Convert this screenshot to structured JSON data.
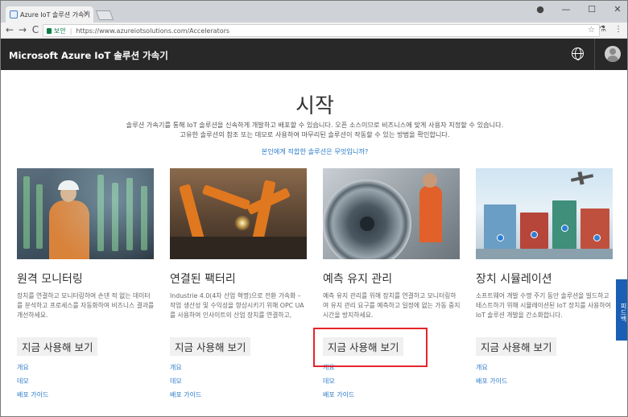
{
  "browser": {
    "tab_title": "Azure IoT 솔루션 가속기",
    "tab_close": "×",
    "url_secure_label": "보안",
    "url": "https://www.azureiotsolutions.com/Accelerators",
    "nav": {
      "back": "←",
      "forward": "→",
      "reload": "C"
    },
    "window_buttons": {
      "profile": "●",
      "minimize": "—",
      "maximize": "☐",
      "close": "✕"
    },
    "bookmark_star": "☆",
    "extension_icon": "⚗",
    "menu_icon": "⋮"
  },
  "header": {
    "title": "Microsoft Azure IoT 솔루션 가속기"
  },
  "main": {
    "heading": "시작",
    "intro_line1": "솔루션 가속기를 통해 IoT 솔루션을 신속하게 개발하고 배포할 수 있습니다. 오픈 소스이므로 비즈니스에 맞게 사용자 지정할 수 있습니다.",
    "intro_line2": "고유한 솔루션의 참조 또는 데모로 사용하여 마무리된 솔루션이 작동할 수 있는 방법을 확인합니다.",
    "intro_link": "본인에게 적합한 솔루션은 무엇입니까?"
  },
  "cards": [
    {
      "title": "원격 모니터링",
      "description": "장치를 연결하고 모니터링하여 손댄 적 없는 데이터를 분석하고 프로세스를 자동화하여 비즈니스 결과를 개선하세요.",
      "cta": "지금 사용해 보기",
      "links": [
        "개요",
        "데모",
        "배포 가이드"
      ]
    },
    {
      "title": "연결된 팩터리",
      "description": "Industrie 4.0(4차 산업 혁명)으로 전환 가속화 – 작업 생산성 및 수익성을 향상시키기 위해 OPC UA를 사용하여 인사이트의 산업 장치를 연결하고,",
      "cta": "지금 사용해 보기",
      "links": [
        "개요",
        "데모",
        "배포 가이드"
      ]
    },
    {
      "title": "예측 유지 관리",
      "description": "예측 유지 관리를 위해 장치를 연결하고 모니터링하여 유지 관리 요구를 예측하고 일정에 없는 가동 중지 시간을 방지하세요.",
      "cta": "지금 사용해 보기",
      "links": [
        "개요",
        "데모",
        "배포 가이드"
      ]
    },
    {
      "title": "장치 시뮬레이션",
      "description": "소프트웨어 개발 수명 주기 동안 솔루션을 빌드하고 테스트하기 위해 시뮬레이션된 IoT 장치를 사용하여 IoT 솔루션 개발을 간소화합니다.",
      "cta": "지금 사용해 보기",
      "links": [
        "개요",
        "배포 가이드"
      ]
    }
  ],
  "feedback_tab": "피드백",
  "colors": {
    "header_bg": "#282828",
    "link": "#2a7ac8",
    "highlight": "#e5242b",
    "feedback": "#1a5fb4"
  }
}
